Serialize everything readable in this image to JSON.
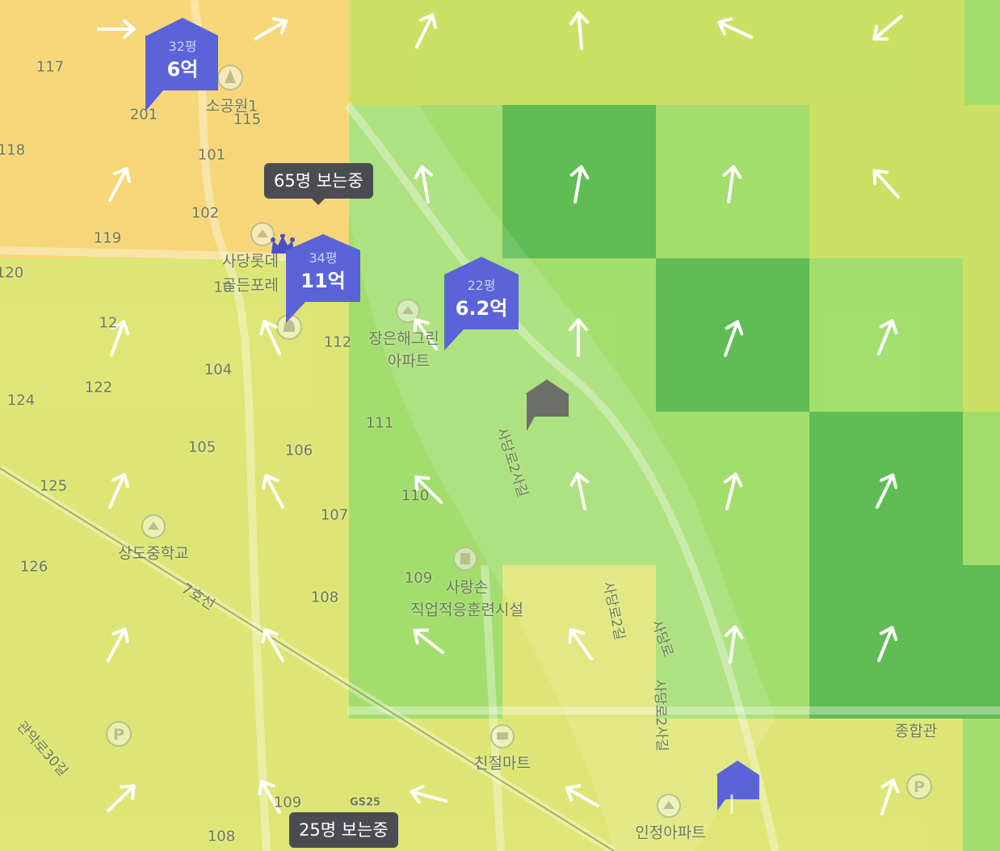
{
  "map": {
    "labels": {
      "l117": "117",
      "l118": "118",
      "l119": "119",
      "l120": "120",
      "l201": "201",
      "l115": "115",
      "l101": "101",
      "l102": "102",
      "l10": "10",
      "l112": "112",
      "l104": "104",
      "l122": "122",
      "l124": "124",
      "l105": "105",
      "l106": "106",
      "l111": "111",
      "l110": "110",
      "l125": "125",
      "l107": "107",
      "l126": "126",
      "l108a": "108",
      "l109a": "109",
      "l109b": "109",
      "l108b": "108",
      "l12x": "12",
      "park": "소공원1",
      "lotte1": "사당롯데",
      "lotte2": "골든포레",
      "jangeun1": "장은해그린",
      "jangeun2": "아파트",
      "school": "상도중학교",
      "line7": "7호선",
      "sarang1": "사랑손",
      "sarang2": "직업적응훈련시설",
      "mart": "친절마트",
      "injeong": "인정아파트",
      "sports": "종합관",
      "road1": "사당로2사길",
      "road2": "사당로2길",
      "road3": "사당로",
      "road4": "사당로2사길",
      "road5": "관악로30길",
      "gs": "GS25"
    }
  },
  "markers": {
    "m1": {
      "area": "32평",
      "price": "6억"
    },
    "m2": {
      "area": "34평",
      "price": "11억"
    },
    "m3": {
      "area": "22평",
      "price": "6.2억"
    }
  },
  "viewers": {
    "top": "65명 보는중",
    "bottom": "25명 보는중"
  },
  "icons": {
    "arrows": "wind-direction-arrow-icon",
    "apartment": "apartment-icon",
    "parking": "parking-icon",
    "crown": "crown-icon",
    "bell": "bell-icon",
    "tree": "tree-icon",
    "building": "building-icon",
    "cart": "shopping-cart-icon",
    "house_gray": "house-gray-icon",
    "house_blue": "house-blue-icon"
  },
  "colors": {
    "yellow_orange": "#f8d572",
    "yellow_green": "#dde56f",
    "light_green": "#9edc67",
    "medium_green": "#74cd55",
    "dark_green": "#55b84b",
    "marker_blue": "#5b63d8",
    "tooltip_dark": "#4b4c52"
  }
}
